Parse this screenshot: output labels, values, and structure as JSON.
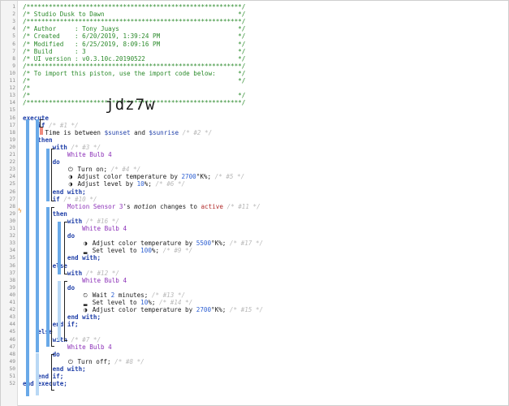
{
  "code_lines": [
    {
      "n": "1",
      "html": "<span class='cmt'>/**********************************************************/</span>"
    },
    {
      "n": "2",
      "html": "<span class='cmt'>/* Studio Dusk to Dawn                                    */</span>"
    },
    {
      "n": "3",
      "html": "<span class='cmt'>/**********************************************************/</span>"
    },
    {
      "n": "4",
      "html": "<span class='cmt'>/* Author     : Tony Juays                                */</span>"
    },
    {
      "n": "5",
      "html": "<span class='cmt'>/* Created    : 6/20/2019, 1:39:24 PM                     */</span>"
    },
    {
      "n": "6",
      "html": "<span class='cmt'>/* Modified   : 6/25/2019, 8:09:16 PM                     */</span>"
    },
    {
      "n": "7",
      "html": "<span class='cmt'>/* Build      : 3                                         */</span>"
    },
    {
      "n": "8",
      "html": "<span class='cmt'>/* UI version : v0.3.10c.20190522                         */</span>"
    },
    {
      "n": "9",
      "html": "<span class='cmt'>/**********************************************************/</span>"
    },
    {
      "n": "10",
      "html": "<span class='cmt'>/* To import this piston, use the import code below:      */</span>"
    },
    {
      "n": "11",
      "html": "<span class='cmt'>/*                                                        */</span>"
    },
    {
      "n": "12",
      "html": "<span class='cmt'>/*</span>"
    },
    {
      "n": "13",
      "html": "<span class='cmt'>/*                                                        */</span>"
    },
    {
      "n": "14",
      "html": "<span class='cmt'>/**********************************************************/</span>"
    },
    {
      "n": "15",
      "html": ""
    },
    {
      "n": "16",
      "html": "<span class='kwb'>execute</span>"
    },
    {
      "n": "17",
      "html": "    <span class='kwb'>if</span> <span class='faint'>/* #1 */</span>"
    },
    {
      "n": "18",
      "html": "      Time is between <span class='var'>$sunset</span> and <span class='var'>$sunrise</span> <span class='faint'>/* #2 */</span>"
    },
    {
      "n": "19",
      "html": "    <span class='kwb'>then</span>"
    },
    {
      "n": "20",
      "html": "        <span class='kwb'>with</span> <span class='faint'>/* #3 */</span>"
    },
    {
      "n": "21",
      "html": "            <span class='dev'>White Bulb 4</span>"
    },
    {
      "n": "22",
      "html": "        <span class='kwb'>do</span>"
    },
    {
      "n": "23",
      "html": "            <span class='icon'>&#x23FB;</span> Turn on; <span class='faint'>/* #4 */</span>"
    },
    {
      "n": "24",
      "html": "            <span class='icon'>&#x25D1;</span> Adjust color temperature by <span class='num'>2700</span>°K%; <span class='faint'>/* #5 */</span>"
    },
    {
      "n": "25",
      "html": "            <span class='icon'>&#x25D1;</span> Adjust level by <span class='num'>10</span>%; <span class='faint'>/* #6 */</span>"
    },
    {
      "n": "26",
      "html": "        <span class='kwb'>end with;</span>"
    },
    {
      "n": "27",
      "html": "        <span class='kwb'>if</span> <span class='faint'>/* #10 */</span>"
    },
    {
      "n": "28",
      "html": "            <span class='dev'>Motion Sensor 3</span>'s <span class='ital'>motion</span> changes to <span class='str'>active</span> <span class='faint'>/* #11 */</span>"
    },
    {
      "n": "29",
      "html": "        <span class='kwb'>then</span>"
    },
    {
      "n": "30",
      "html": "            <span class='kwb'>with</span> <span class='faint'>/* #16 */</span>"
    },
    {
      "n": "31",
      "html": "                <span class='dev'>White Bulb 4</span>"
    },
    {
      "n": "32",
      "html": "            <span class='kwb'>do</span>"
    },
    {
      "n": "33",
      "html": "                <span class='icon'>&#x25D1;</span> Adjust color temperature by <span class='num'>5500</span>°K%; <span class='faint'>/* #17 */</span>"
    },
    {
      "n": "34",
      "html": "                <span class='icon'>&#x2582;</span> Set level to <span class='num'>100</span>%; <span class='faint'>/* #9 */</span>"
    },
    {
      "n": "35",
      "html": "            <span class='kwb'>end with;</span>"
    },
    {
      "n": "36",
      "html": "        <span class='kwb'>else</span>"
    },
    {
      "n": "37",
      "html": "            <span class='kwb'>with</span> <span class='faint'>/* #12 */</span>"
    },
    {
      "n": "38",
      "html": "                <span class='dev'>White Bulb 4</span>"
    },
    {
      "n": "39",
      "html": "            <span class='kwb'>do</span>"
    },
    {
      "n": "40",
      "html": "                <span class='icon'>&#x23F2;</span> Wait <span class='num'>2</span> minutes; <span class='faint'>/* #13 */</span>"
    },
    {
      "n": "41",
      "html": "                <span class='icon'>&#x2582;</span> Set level to <span class='num'>10</span>%; <span class='faint'>/* #14 */</span>"
    },
    {
      "n": "42",
      "html": "                <span class='icon'>&#x25D1;</span> Adjust color temperature by <span class='num'>2700</span>°K%; <span class='faint'>/* #15 */</span>"
    },
    {
      "n": "43",
      "html": "            <span class='kwb'>end with;</span>"
    },
    {
      "n": "44",
      "html": "        <span class='kwb'>end if;</span>"
    },
    {
      "n": "45",
      "html": "    <span class='kwb'>else</span>"
    },
    {
      "n": "46",
      "html": "        <span class='kwb'>with</span> <span class='faint'>/* #7 */</span>"
    },
    {
      "n": "47",
      "html": "            <span class='dev'>White Bulb 4</span>"
    },
    {
      "n": "48",
      "html": "        <span class='kwb'>do</span>"
    },
    {
      "n": "49",
      "html": "            <span class='icon'>&#x23FB;</span> Turn off; <span class='faint'>/* #8 */</span>"
    },
    {
      "n": "50",
      "html": "        <span class='kwb'>end with;</span>"
    },
    {
      "n": "51",
      "html": "    <span class='kwb'>end if;</span>"
    },
    {
      "n": "52",
      "html": "<span class='kwb'>end execute;</span>"
    }
  ],
  "import_code": "jdz7w",
  "colors": {
    "comment": "#2b8a2b",
    "keyword": "#1f3fa8",
    "device": "#8c31b8",
    "active_bar": "#69a9e8",
    "inactive_bar": "#b9d8f5",
    "condition_marker": "#f08b7d"
  }
}
